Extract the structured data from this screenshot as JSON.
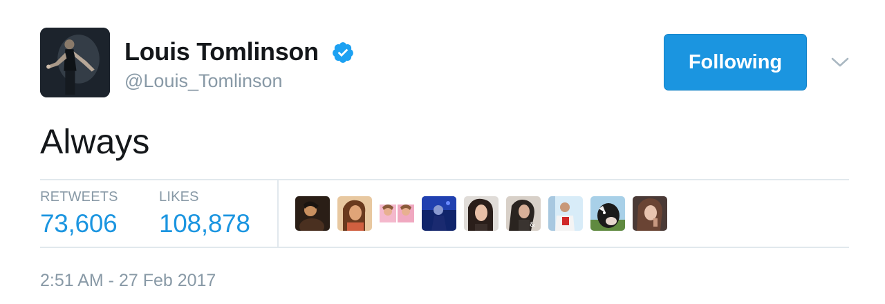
{
  "author": {
    "name": "Louis Tomlinson",
    "handle": "@Louis_Tomlinson",
    "verified": true,
    "avatar_icon": "profile-photo"
  },
  "actions": {
    "follow_label": "Following",
    "menu_icon": "chevron-down-icon"
  },
  "tweet": {
    "text": "Always"
  },
  "stats": {
    "retweets_label": "RETWEETS",
    "retweets_value": "73,606",
    "likes_label": "LIKES",
    "likes_value": "108,878"
  },
  "likers": [
    {
      "icon": "liker-avatar",
      "color": "#3a2a1e"
    },
    {
      "icon": "liker-avatar",
      "color": "#c8845a"
    },
    {
      "icon": "liker-avatar",
      "color": "#e8a0b8"
    },
    {
      "icon": "liker-avatar",
      "color": "#1e3a8a"
    },
    {
      "icon": "liker-avatar",
      "color": "#3b2f2f"
    },
    {
      "icon": "liker-avatar",
      "color": "#4a4038"
    },
    {
      "icon": "liker-avatar",
      "color": "#c0d8ea"
    },
    {
      "icon": "liker-avatar",
      "color": "#2a2a2a"
    },
    {
      "icon": "liker-avatar",
      "color": "#5a4440"
    }
  ],
  "timestamp": "2:51 AM - 27 Feb 2017",
  "colors": {
    "accent": "#1b95e0",
    "text": "#14171a",
    "muted": "#8899a6",
    "divider": "#e1e8ed"
  }
}
